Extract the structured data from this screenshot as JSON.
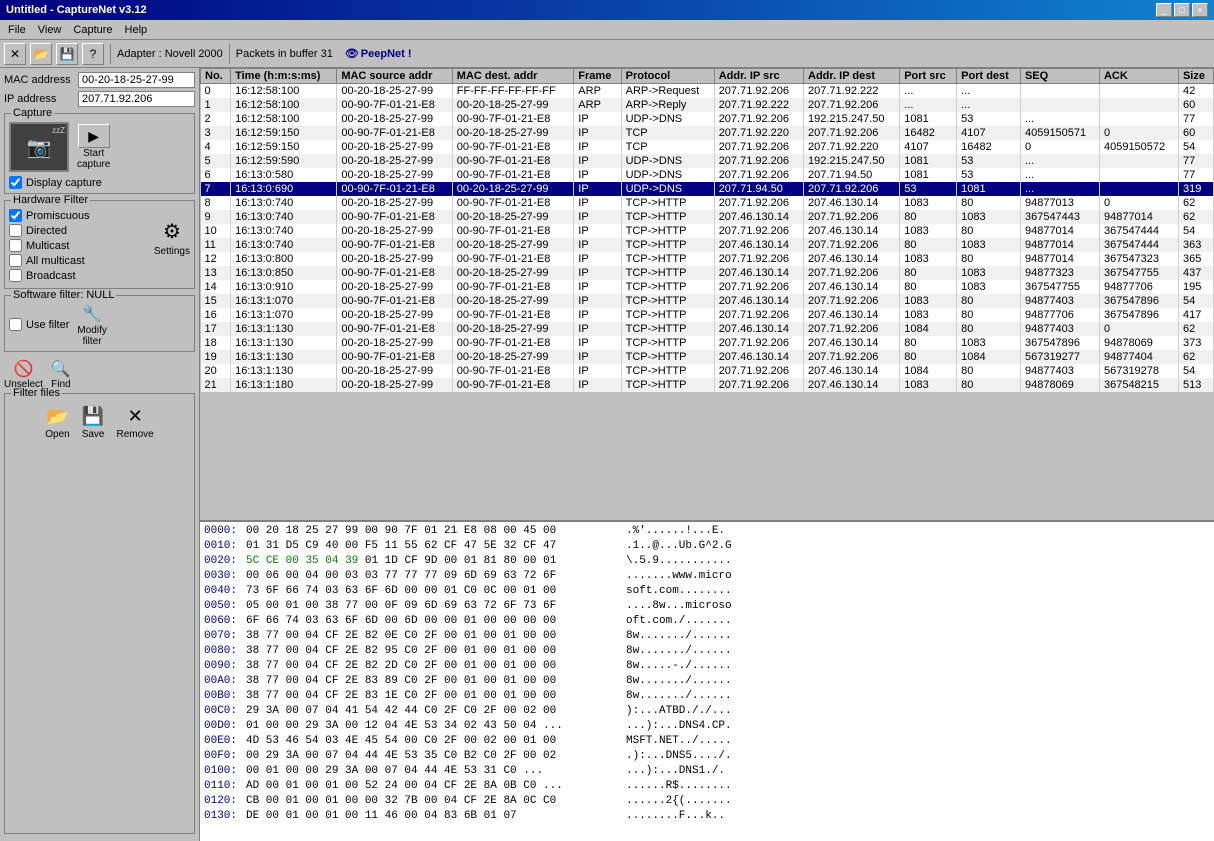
{
  "app": {
    "title": "Untitled - CaptureNet  v3.12",
    "title_icon": "📡"
  },
  "titlebar_buttons": [
    "_",
    "□",
    "×"
  ],
  "menu": {
    "items": [
      "File",
      "View",
      "Capture",
      "Help"
    ]
  },
  "toolbar": {
    "adapter_label": "Adapter : Novell 2000",
    "packets_label": "Packets in buffer 31",
    "peepnet_label": "PeepNet !"
  },
  "left_panel": {
    "mac_label": "MAC address",
    "mac_value": "00-20-18-25-27-99",
    "ip_label": "IP address",
    "ip_value": "207.71.92.206",
    "capture_group": "Capture",
    "display_capture": "Display capture",
    "start_capture": "Start\ncapture",
    "hw_filter": "Hardware Filter",
    "promiscuous": "Promiscuous",
    "directed": "Directed",
    "multicast": "Multicast",
    "all_multicast": "All multicast",
    "broadcast": "Broadcast",
    "settings": "Settings",
    "sw_filter": "Software filter: NULL",
    "use_filter": "Use filter",
    "modify_filter": "Modify\nfilter",
    "unselect": "Unselect",
    "find": "Find",
    "filter_files": "Filter files",
    "open": "Open",
    "save": "Save",
    "remove": "Remove"
  },
  "table": {
    "columns": [
      "No.",
      "Time (h:m:s:ms)",
      "MAC source addr",
      "MAC dest. addr",
      "Frame",
      "Protocol",
      "Addr. IP src",
      "Addr. IP dest",
      "Port src",
      "Port dest",
      "SEQ",
      "ACK",
      "Size"
    ],
    "rows": [
      [
        "0",
        "16:12:58:100",
        "00-20-18-25-27-99",
        "FF-FF-FF-FF-FF-FF",
        "ARP",
        "ARP->Request",
        "207.71.92.206",
        "207.71.92.222",
        "...",
        "...",
        "",
        "",
        "42"
      ],
      [
        "1",
        "16:12:58:100",
        "00-90-7F-01-21-E8",
        "00-20-18-25-27-99",
        "ARP",
        "ARP->Reply",
        "207.71.92.222",
        "207.71.92.206",
        "...",
        "...",
        "",
        "",
        "60"
      ],
      [
        "2",
        "16:12:58:100",
        "00-20-18-25-27-99",
        "00-90-7F-01-21-E8",
        "IP",
        "UDP->DNS",
        "207.71.92.206",
        "192.215.247.50",
        "1081",
        "53",
        "...",
        "",
        "77"
      ],
      [
        "3",
        "16:12:59:150",
        "00-90-7F-01-21-E8",
        "00-20-18-25-27-99",
        "IP",
        "TCP",
        "207.71.92.220",
        "207.71.92.206",
        "16482",
        "4107",
        "4059150571",
        "0",
        "60"
      ],
      [
        "4",
        "16:12:59:150",
        "00-20-18-25-27-99",
        "00-90-7F-01-21-E8",
        "IP",
        "TCP",
        "207.71.92.206",
        "207.71.92.220",
        "4107",
        "16482",
        "0",
        "4059150572",
        "54"
      ],
      [
        "5",
        "16:12:59:590",
        "00-20-18-25-27-99",
        "00-90-7F-01-21-E8",
        "IP",
        "UDP->DNS",
        "207.71.92.206",
        "192.215.247.50",
        "1081",
        "53",
        "...",
        "",
        "77"
      ],
      [
        "6",
        "16:13:0:580",
        "00-20-18-25-27-99",
        "00-90-7F-01-21-E8",
        "IP",
        "UDP->DNS",
        "207.71.92.206",
        "207.71.94.50",
        "1081",
        "53",
        "...",
        "",
        "77"
      ],
      [
        "7",
        "16:13:0:690",
        "00-90-7F-01-21-E8",
        "00-20-18-25-27-99",
        "IP",
        "UDP->DNS",
        "207.71.94.50",
        "207.71.92.206",
        "53",
        "1081",
        "...",
        "",
        "319"
      ],
      [
        "8",
        "16:13:0:740",
        "00-20-18-25-27-99",
        "00-90-7F-01-21-E8",
        "IP",
        "TCP->HTTP",
        "207.71.92.206",
        "207.46.130.14",
        "1083",
        "80",
        "94877013",
        "0",
        "62"
      ],
      [
        "9",
        "16:13:0:740",
        "00-90-7F-01-21-E8",
        "00-20-18-25-27-99",
        "IP",
        "TCP->HTTP",
        "207.46.130.14",
        "207.71.92.206",
        "80",
        "1083",
        "367547443",
        "94877014",
        "62"
      ],
      [
        "10",
        "16:13:0:740",
        "00-20-18-25-27-99",
        "00-90-7F-01-21-E8",
        "IP",
        "TCP->HTTP",
        "207.71.92.206",
        "207.46.130.14",
        "1083",
        "80",
        "94877014",
        "367547444",
        "54"
      ],
      [
        "11",
        "16:13:0:740",
        "00-90-7F-01-21-E8",
        "00-20-18-25-27-99",
        "IP",
        "TCP->HTTP",
        "207.46.130.14",
        "207.71.92.206",
        "80",
        "1083",
        "94877014",
        "367547444",
        "363"
      ],
      [
        "12",
        "16:13:0:800",
        "00-20-18-25-27-99",
        "00-90-7F-01-21-E8",
        "IP",
        "TCP->HTTP",
        "207.71.92.206",
        "207.46.130.14",
        "1083",
        "80",
        "94877014",
        "367547323",
        "365"
      ],
      [
        "13",
        "16:13:0:850",
        "00-90-7F-01-21-E8",
        "00-20-18-25-27-99",
        "IP",
        "TCP->HTTP",
        "207.46.130.14",
        "207.71.92.206",
        "80",
        "1083",
        "94877323",
        "367547755",
        "437"
      ],
      [
        "14",
        "16:13:0:910",
        "00-20-18-25-27-99",
        "00-90-7F-01-21-E8",
        "IP",
        "TCP->HTTP",
        "207.71.92.206",
        "207.46.130.14",
        "80",
        "1083",
        "367547755",
        "94877706",
        "195"
      ],
      [
        "15",
        "16:13:1:070",
        "00-90-7F-01-21-E8",
        "00-20-18-25-27-99",
        "IP",
        "TCP->HTTP",
        "207.46.130.14",
        "207.71.92.206",
        "1083",
        "80",
        "94877403",
        "367547896",
        "54"
      ],
      [
        "16",
        "16:13:1:070",
        "00-20-18-25-27-99",
        "00-90-7F-01-21-E8",
        "IP",
        "TCP->HTTP",
        "207.71.92.206",
        "207.46.130.14",
        "1083",
        "80",
        "94877706",
        "367547896",
        "417"
      ],
      [
        "17",
        "16:13:1:130",
        "00-90-7F-01-21-E8",
        "00-20-18-25-27-99",
        "IP",
        "TCP->HTTP",
        "207.46.130.14",
        "207.71.92.206",
        "1084",
        "80",
        "94877403",
        "0",
        "62"
      ],
      [
        "18",
        "16:13:1:130",
        "00-20-18-25-27-99",
        "00-90-7F-01-21-E8",
        "IP",
        "TCP->HTTP",
        "207.71.92.206",
        "207.46.130.14",
        "80",
        "1083",
        "367547896",
        "94878069",
        "373"
      ],
      [
        "19",
        "16:13:1:130",
        "00-90-7F-01-21-E8",
        "00-20-18-25-27-99",
        "IP",
        "TCP->HTTP",
        "207.46.130.14",
        "207.71.92.206",
        "80",
        "1084",
        "567319277",
        "94877404",
        "62"
      ],
      [
        "20",
        "16:13:1:130",
        "00-20-18-25-27-99",
        "00-90-7F-01-21-E8",
        "IP",
        "TCP->HTTP",
        "207.71.92.206",
        "207.46.130.14",
        "1084",
        "80",
        "94877403",
        "567319278",
        "54"
      ],
      [
        "21",
        "16:13:1:180",
        "00-20-18-25-27-99",
        "00-90-7F-01-21-E8",
        "IP",
        "TCP->HTTP",
        "207.71.92.206",
        "207.46.130.14",
        "1083",
        "80",
        "94878069",
        "367548215",
        "513"
      ]
    ],
    "selected_row": 7
  },
  "hex_dump": {
    "lines": [
      {
        "offset": "0000:",
        "bytes": "00 20 18 25 27 99 00 90  7F 01 21 E8 08 00 45 00",
        "ascii": " .%'......!...E.",
        "highlight_bytes": ""
      },
      {
        "offset": "0010:",
        "bytes": "01 31 D5 C9 40 00 F5 11  55 62 CF 47 5E 32 CF 47",
        "ascii": ".1..@...Ub.G^2.G",
        "highlight_bytes": ""
      },
      {
        "offset": "0020:",
        "bytes": "5C CE 00 35 04 39 01 1D  CF 9D 00 01 81 80 00 01",
        "ascii": "\\.5.9...........",
        "highlight_start": [
          0,
          1,
          2,
          3,
          4,
          5
        ],
        "highlight_color": "#008000"
      },
      {
        "offset": "0030:",
        "bytes": "00 06 00 04 00 03 03 77  77 77 09 6D 69 63 72 6F",
        "ascii": ".......www.micro",
        "highlight_bytes": ""
      },
      {
        "offset": "0040:",
        "bytes": "73 6F 66 74 03 63 6F 6D  00 00 01 C0 0C 00 01 00",
        "ascii": "soft.com........",
        "highlight_bytes": ""
      },
      {
        "offset": "0050:",
        "bytes": "05 00 01 00 38 77 00 0F  09 6D 69 63 72 6F 73 6F",
        "ascii": "....8w...microso",
        "highlight_bytes": ""
      },
      {
        "offset": "0060:",
        "bytes": "6F 66 74 03 63 6F 6D 00  6D 00 00 01 00 00 00 00",
        "ascii": "oft.com./.......",
        "highlight_bytes": ""
      },
      {
        "offset": "0070:",
        "bytes": "38 77 00 04 CF 2E 82 0E  C0 2F 00 01 00 01 00 00",
        "ascii": "8w......./......",
        "highlight_bytes": ""
      },
      {
        "offset": "0080:",
        "bytes": "38 77 00 04 CF 2E 82 95  C0 2F 00 01 00 01 00 00",
        "ascii": "8w......./......",
        "highlight_bytes": ""
      },
      {
        "offset": "0090:",
        "bytes": "38 77 00 04 CF 2E 82 2D  C0 2F 00 01 00 01 00 00",
        "ascii": "8w.....-./......",
        "highlight_bytes": ""
      },
      {
        "offset": "00A0:",
        "bytes": "38 77 00 04 CF 2E 83 89  C0 2F 00 01 00 01 00 00",
        "ascii": "8w......./......",
        "highlight_bytes": ""
      },
      {
        "offset": "00B0:",
        "bytes": "38 77 00 04 CF 2E 83 1E  C0 2F 00 01 00 01 00 00",
        "ascii": "8w......./......",
        "highlight_bytes": ""
      },
      {
        "offset": "00C0:",
        "bytes": "29 3A 00 07 04 41 54 42  44 C0 2F C0 2F 00 02 00",
        "ascii": "):...ATBD././...",
        "highlight_bytes": ""
      },
      {
        "offset": "00D0:",
        "bytes": "01 00 00 29 3A 00 12 04  4E 53 34 02 43 50 04 ...",
        "ascii": "...):...DNS4.CP.",
        "highlight_bytes": ""
      },
      {
        "offset": "00E0:",
        "bytes": "4D 53 46 54 03 4E 45 54  00 C0 2F 00 02 00 01 00",
        "ascii": "MSFT.NET../.....",
        "highlight_bytes": ""
      },
      {
        "offset": "00F0:",
        "bytes": "00 29 3A 00 07 04 44 4E  53 35 C0 B2 C0 2F 00 02",
        "ascii": ".):...DNS5..../.",
        "highlight_bytes": ""
      },
      {
        "offset": "0100:",
        "bytes": "00 01 00 00 29 3A 00 07  04 44 4E 53 31 C0 ...   ",
        "ascii": "...):...DNS1./.",
        "highlight_bytes": ""
      },
      {
        "offset": "0110:",
        "bytes": "AD 00 01 00 01 00 52 24  00 04 CF 2E 8A 0B C0 ...",
        "ascii": "......R$........",
        "highlight_bytes": ""
      },
      {
        "offset": "0120:",
        "bytes": "CB 00 01 00 01 00 00 32  7B 00 04 CF 2E 8A 0C C0",
        "ascii": "......2{(.......",
        "highlight_bytes": ""
      },
      {
        "offset": "0130:",
        "bytes": "DE 00 01 00 01 00 11 46  00 04 83 6B 01 07",
        "ascii": "........F...k..",
        "highlight_bytes": ""
      }
    ]
  },
  "colors": {
    "selected_row_bg": "#000080",
    "selected_row_text": "#ffffff",
    "title_bar_start": "#000080",
    "title_bar_end": "#1084d0",
    "hex_highlight": "#008000"
  }
}
